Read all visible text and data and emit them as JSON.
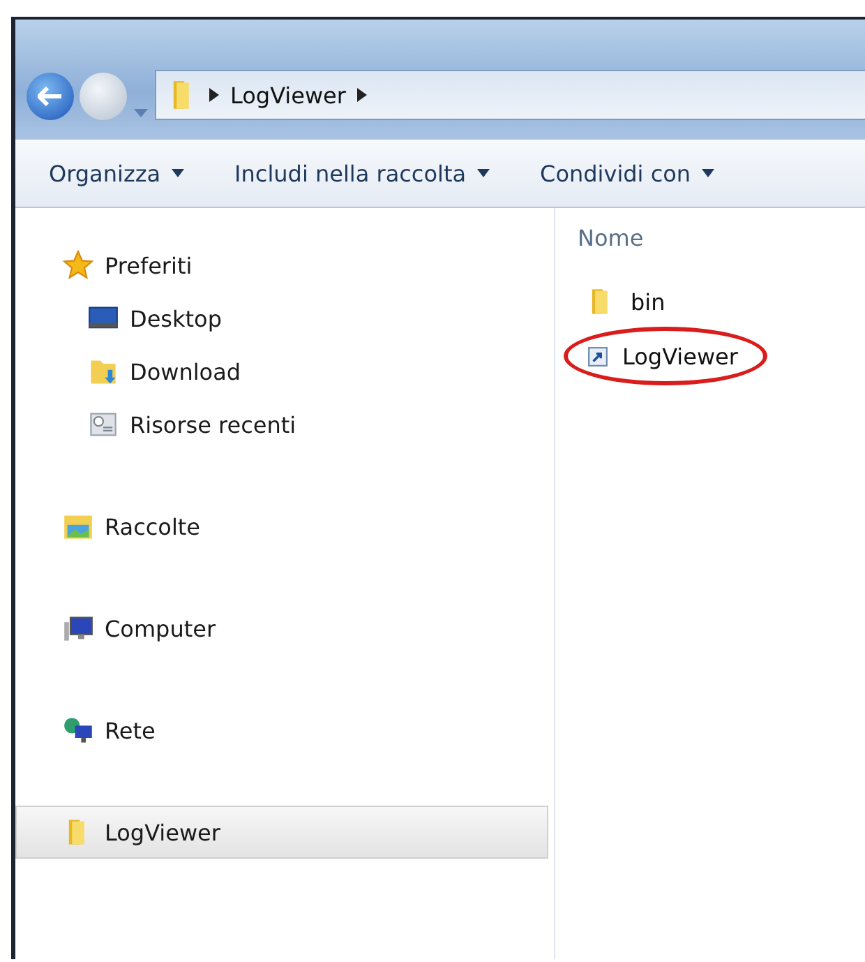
{
  "address_bar": {
    "path": [
      "LogViewer"
    ]
  },
  "toolbar": [
    {
      "label": "Organizza"
    },
    {
      "label": "Includi nella raccolta"
    },
    {
      "label": "Condividi con"
    }
  ],
  "sidebar": {
    "items": [
      {
        "label": "Preferiti",
        "kind": "star",
        "selected": false,
        "children": [
          {
            "label": "Desktop",
            "kind": "desktop",
            "selected": false
          },
          {
            "label": "Download",
            "kind": "download",
            "selected": false
          },
          {
            "label": "Risorse recenti",
            "kind": "recent",
            "selected": false
          }
        ]
      },
      {
        "label": "Raccolte",
        "kind": "library",
        "selected": false
      },
      {
        "label": "Computer",
        "kind": "computer",
        "selected": false
      },
      {
        "label": "Rete",
        "kind": "network",
        "selected": false
      },
      {
        "label": "LogViewer",
        "kind": "folder",
        "selected": true
      }
    ]
  },
  "file_list": {
    "columns": [
      "Nome"
    ],
    "rows": [
      {
        "name": "bin",
        "kind": "folder",
        "circled": false
      },
      {
        "name": "LogViewer",
        "kind": "shortcut",
        "circled": true
      }
    ]
  }
}
